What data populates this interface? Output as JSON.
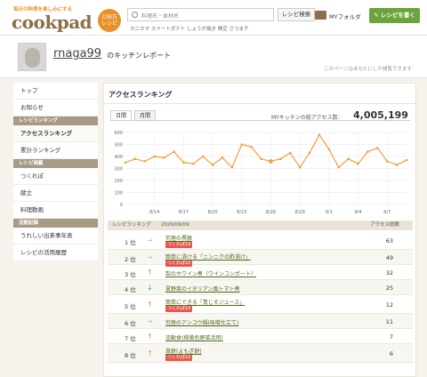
{
  "header": {
    "tagline": "毎日の料理を楽しみにする",
    "logo": "cookpad",
    "recipe_count": "338万",
    "recipe_count_unit": "レシピ",
    "search_placeholder": "料理名・食材名",
    "search_button": "レシピ検索",
    "keywords": "カニカマ  スイートポテト  しょうが焼き  検豆  さつまチ",
    "my_folder": "MYフォルダ",
    "write_recipe": "レシピを書く"
  },
  "user": {
    "name": "rnaga99",
    "kitchen_label": "のキッチンレポート",
    "visibility_note": "このページはあなたにしか閲覧できます"
  },
  "sidebar": [
    {
      "type": "item",
      "label": "トップ"
    },
    {
      "type": "item",
      "label": "お知らせ"
    },
    {
      "type": "head",
      "label": "レシピランキング"
    },
    {
      "type": "item",
      "label": "アクセスランキング",
      "active": true
    },
    {
      "type": "item",
      "label": "累計ランキング"
    },
    {
      "type": "head",
      "label": "レシピ掲載"
    },
    {
      "type": "item",
      "label": "つくれぽ"
    },
    {
      "type": "item",
      "label": "献立"
    },
    {
      "type": "item",
      "label": "料理動画"
    },
    {
      "type": "head",
      "label": "活動記録"
    },
    {
      "type": "item",
      "label": "うれしい出来事年表"
    },
    {
      "type": "item",
      "label": "レシピの活用履歴"
    }
  ],
  "main": {
    "title": "アクセスランキング",
    "tab_daily": "日間",
    "tab_monthly": "月間",
    "total_label": "MYキッチンの総アクセス数：",
    "total_value": "4,005,199"
  },
  "chart_data": {
    "type": "line",
    "x": [
      "8/11",
      "8/12",
      "8/13",
      "8/14",
      "8/15",
      "8/16",
      "8/17",
      "8/18",
      "8/19",
      "8/20",
      "8/21",
      "8/22",
      "8/23",
      "8/24",
      "8/25",
      "8/26",
      "8/27",
      "8/28",
      "8/29",
      "8/30",
      "8/31",
      "9/1",
      "9/2",
      "9/3",
      "9/4",
      "9/5",
      "9/6",
      "9/7",
      "9/8",
      "9/9"
    ],
    "x_tick_labels": [
      "8/14",
      "8/17",
      "8/20",
      "8/23",
      "8/26",
      "8/29",
      "9/1",
      "9/4",
      "9/7"
    ],
    "values": [
      350,
      380,
      360,
      400,
      390,
      440,
      350,
      340,
      400,
      330,
      390,
      310,
      500,
      480,
      380,
      360,
      380,
      430,
      310,
      430,
      580,
      460,
      310,
      380,
      340,
      440,
      470,
      360,
      330,
      370
    ],
    "ylim": [
      0,
      600
    ],
    "yticks": [
      0,
      100,
      200,
      300,
      400,
      500,
      600
    ],
    "grid": true,
    "color": "#f0a03c",
    "highlight_index": 15
  },
  "ranking": {
    "col_rank": "レシピランキング",
    "col_date": "2020/09/09",
    "col_count": "アクセス総数",
    "rows": [
      {
        "rank": "1 位",
        "arrow": "flat",
        "title": "究極の黒豚",
        "tag": "つくれぽ10",
        "count": "63"
      },
      {
        "rank": "2 位",
        "arrow": "flat",
        "title": "簡単に漬ける「ニンニクの酢漬け」",
        "tag": "つくれぽ10",
        "count": "49"
      },
      {
        "rank": "3 位",
        "arrow": "up",
        "title": "梨のホワイン煮（ワインコンポート）",
        "tag": "",
        "count": "32"
      },
      {
        "rank": "4 位",
        "arrow": "down",
        "title": "夏野菜のイタリアン風トマト煮",
        "tag": "",
        "count": "25"
      },
      {
        "rank": "5 位",
        "arrow": "up",
        "title": "簡単にできる「青じそジュース」",
        "tag": "つくれぽ10",
        "count": "12"
      },
      {
        "rank": "6 位",
        "arrow": "flat",
        "title": "究極のアンコウ鍋(味噌仕立て)",
        "tag": "",
        "count": "11"
      },
      {
        "rank": "7 位",
        "arrow": "up",
        "title": "流動食(緑黄色野菜活用)",
        "tag": "",
        "count": "7"
      },
      {
        "rank": "8 位",
        "arrow": "up",
        "title": "草餅(よもぎ餅)",
        "tag": "つくれぽ10",
        "count": "6"
      }
    ]
  }
}
